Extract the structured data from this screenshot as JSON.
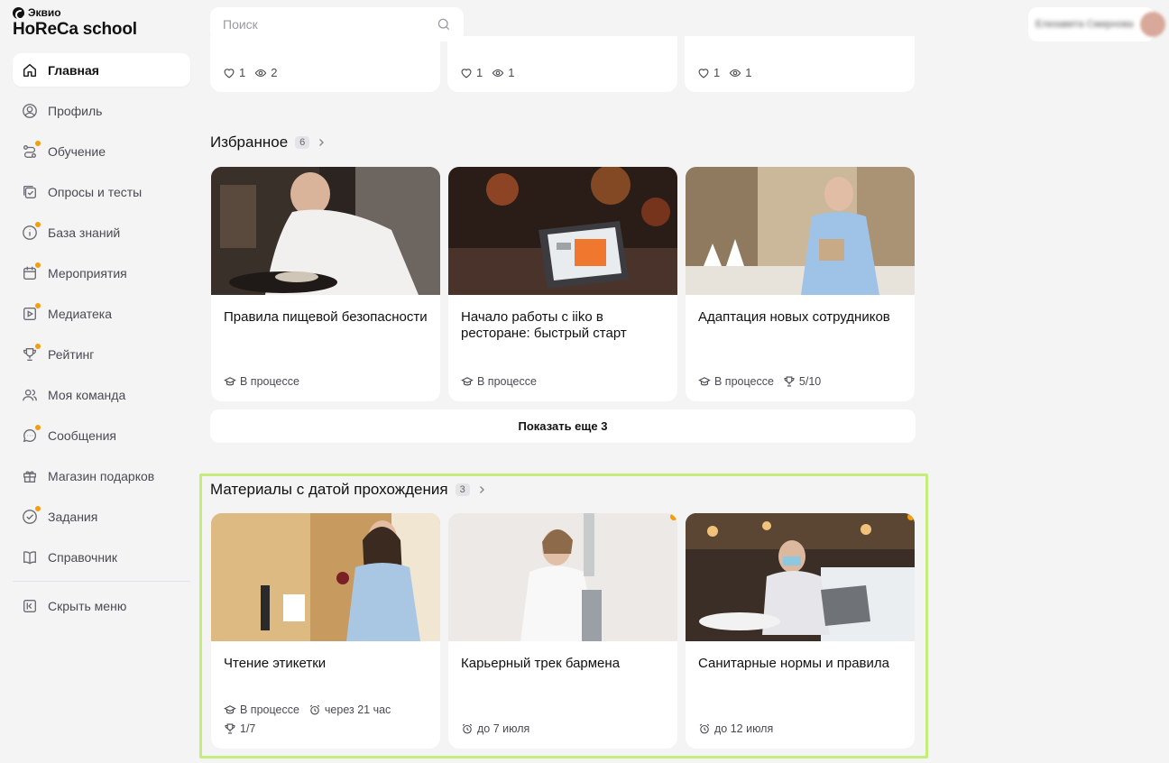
{
  "brand": {
    "company": "Эквио",
    "school": "HoReCa school"
  },
  "search": {
    "placeholder": "Поиск"
  },
  "user": {
    "name": "Елизавета Смирнова"
  },
  "nav": {
    "items": [
      {
        "label": "Главная",
        "icon": "home-icon",
        "active": true,
        "dot": false
      },
      {
        "label": "Профиль",
        "icon": "profile-icon",
        "dot": false
      },
      {
        "label": "Обучение",
        "icon": "learning-icon",
        "dot": true
      },
      {
        "label": "Опросы и тесты",
        "icon": "tests-icon",
        "dot": false
      },
      {
        "label": "База знаний",
        "icon": "info-icon",
        "dot": true
      },
      {
        "label": "Мероприятия",
        "icon": "calendar-icon",
        "dot": true
      },
      {
        "label": "Медиатека",
        "icon": "media-icon",
        "dot": true
      },
      {
        "label": "Рейтинг",
        "icon": "trophy-icon",
        "dot": true
      },
      {
        "label": "Моя команда",
        "icon": "team-icon",
        "dot": false
      },
      {
        "label": "Сообщения",
        "icon": "chat-icon",
        "dot": true
      },
      {
        "label": "Магазин подарков",
        "icon": "gift-icon",
        "dot": false
      },
      {
        "label": "Задания",
        "icon": "task-icon",
        "dot": true
      },
      {
        "label": "Справочник",
        "icon": "book-icon",
        "dot": false
      }
    ],
    "hide_menu": "Скрыть меню"
  },
  "top_cards": [
    {
      "likes": "1",
      "views": "2"
    },
    {
      "likes": "1",
      "views": "1"
    },
    {
      "likes": "1",
      "views": "1"
    }
  ],
  "favorites": {
    "title": "Избранное",
    "count": "6",
    "cards": [
      {
        "title": "Правила пищевой безопасности",
        "status": "В процессе"
      },
      {
        "title": "Начало работы с iiko в ресторане: быстрый старт",
        "status": "В процессе"
      },
      {
        "title": "Адаптация новых сотрудников",
        "status": "В процессе",
        "score": "5/10"
      }
    ],
    "show_more": "Показать еще 3"
  },
  "deadline": {
    "title": "Материалы с датой прохождения",
    "count": "3",
    "cards": [
      {
        "title": "Чтение этикетки",
        "status": "В процессе",
        "deadline": "через 21 час",
        "score": "1/7"
      },
      {
        "title": "Карьерный трек бармена",
        "deadline": "до 7 июля"
      },
      {
        "title": "Санитарные нормы и правила",
        "deadline": "до 12 июля"
      }
    ]
  },
  "colors": {
    "accent_dot": "#f59e0b",
    "highlight": "#c5ed7c",
    "background": "#f4f4f5"
  }
}
